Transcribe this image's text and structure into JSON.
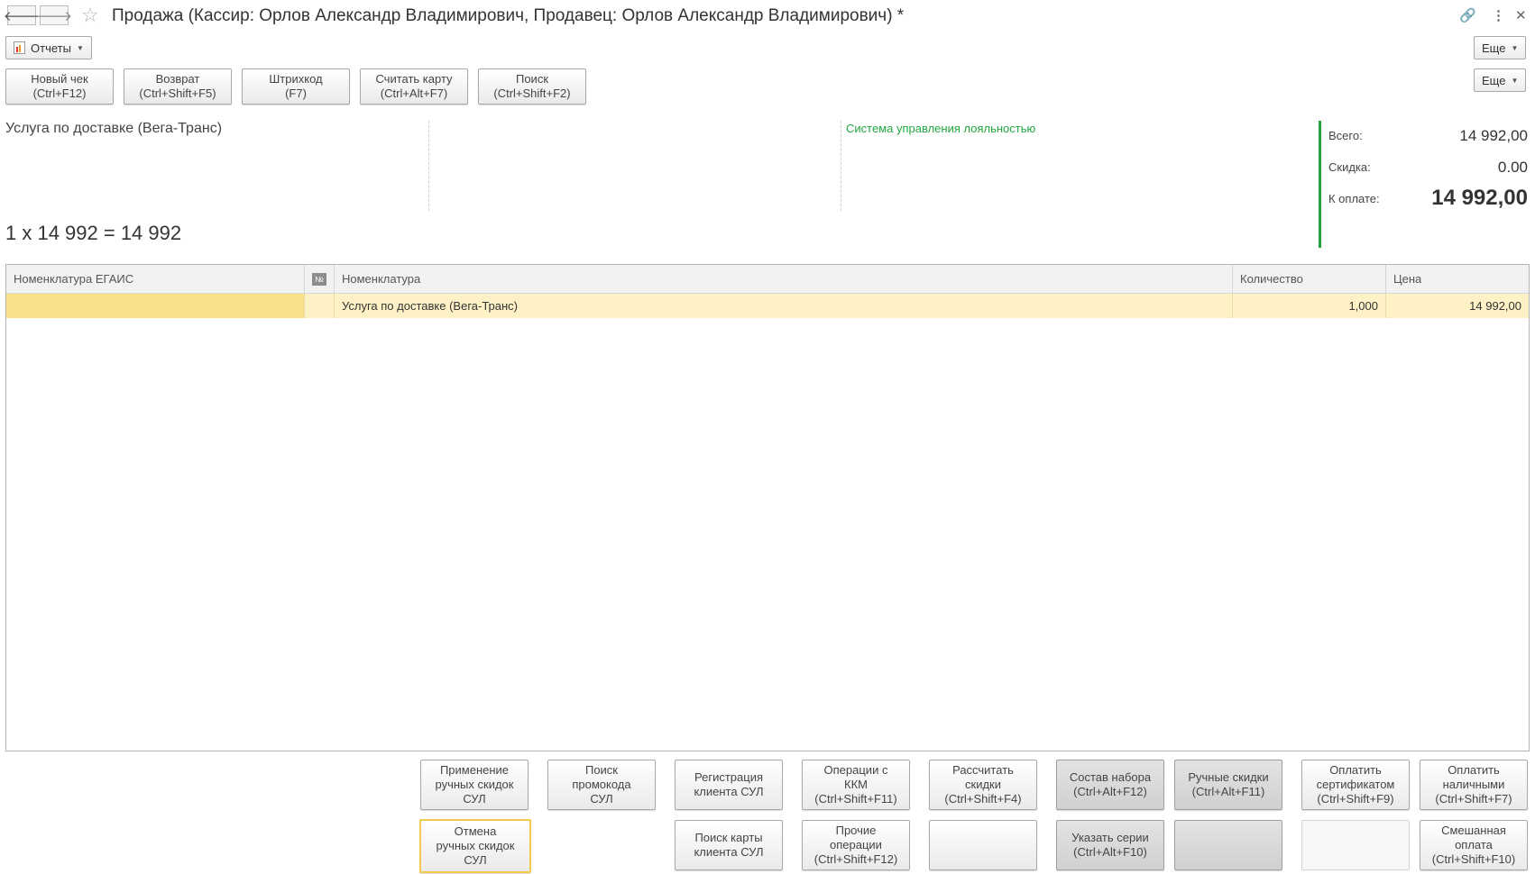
{
  "window": {
    "title": "Продажа (Кассир: Орлов Александр Владимирович, Продавец: Орлов Александр Владимирович) *"
  },
  "toolbar": {
    "reports_label": "Отчеты",
    "more_label": "Еще"
  },
  "actions": {
    "buttons": [
      "Новый чек\n(Ctrl+F12)",
      "Возврат\n(Ctrl+Shift+F5)",
      "Штрихкод\n(F7)",
      "Считать карту\n(Ctrl+Alt+F7)",
      "Поиск\n(Ctrl+Shift+F2)"
    ],
    "more_label": "Еще"
  },
  "info": {
    "product_name": "Услуга по доставке (Вега-Транс)",
    "loyalty_label": "Система управления лояльностью",
    "calc_line": "1 x 14 992 = 14 992",
    "accent_color": "#22a640"
  },
  "totals": {
    "total_label": "Всего:",
    "total_value": "14 992,00",
    "discount_label": "Скидка:",
    "discount_value": "0.00",
    "pay_label": "К оплате:",
    "pay_value": "14 992,00"
  },
  "table": {
    "columns": [
      "Номенклатура ЕГАИС",
      "№",
      "Номенклатура",
      "Количество",
      "Цена"
    ],
    "rows": [
      {
        "egais": "",
        "num": "",
        "name": "Услуга по доставке (Вега-Транс)",
        "qty": "1,000",
        "price": "14 992,00"
      }
    ],
    "selected_row_color": "#fdf1c5"
  },
  "bottom_buttons": {
    "row1": [
      "Применение\nручных скидок\nСУЛ",
      "Поиск\nпромокода\nСУЛ",
      "Регистрация\nклиента СУЛ",
      "Операции с\nККМ\n(Ctrl+Shift+F11)",
      "Рассчитать\nскидки\n(Ctrl+Shift+F4)",
      "Состав набора\n(Ctrl+Alt+F12)",
      "Ручные скидки\n(Ctrl+Alt+F11)",
      "Оплатить\nсертификатом\n(Ctrl+Shift+F9)",
      "Оплатить\nналичными\n(Ctrl+Shift+F7)"
    ],
    "row2": [
      "Отмена\nручных скидок\nСУЛ",
      "Поиск карты\nклиента СУЛ",
      "Прочие\nоперации\n(Ctrl+Shift+F12)",
      "",
      "Указать серии\n(Ctrl+Alt+F10)",
      "",
      "Смешанная\nоплата\n(Ctrl+Shift+F10)"
    ]
  }
}
